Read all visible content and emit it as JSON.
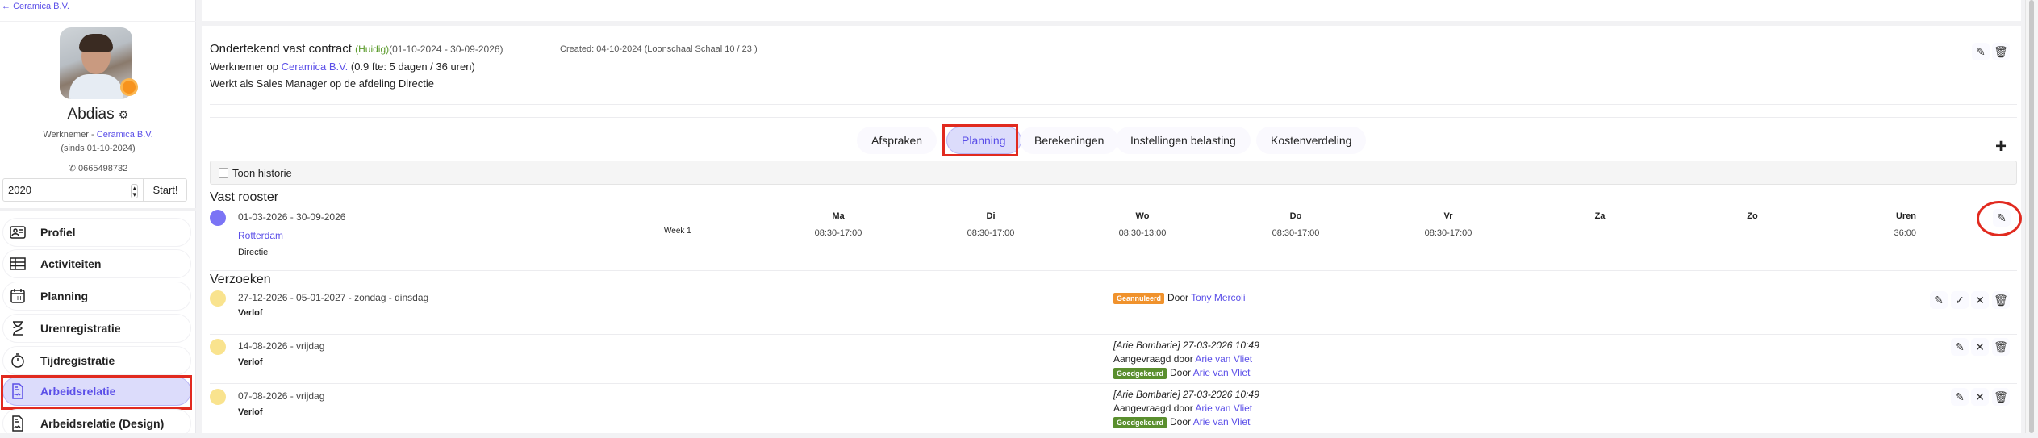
{
  "sidebar": {
    "back_link": "Ceramica B.V.",
    "name": "Abdias",
    "role": "Werknemer - ",
    "company": "Ceramica B.V.",
    "since": "(sinds 01-10-2024)",
    "phone": "0665498732",
    "year_value": "2020",
    "start_label": "Start!",
    "nav": [
      {
        "label": "Profiel",
        "icon": "id-card-icon"
      },
      {
        "label": "Activiteiten",
        "icon": "table-icon"
      },
      {
        "label": "Planning",
        "icon": "calendar-icon"
      },
      {
        "label": "Urenregistratie",
        "icon": "hourglass-icon"
      },
      {
        "label": "Tijdregistratie",
        "icon": "stopwatch-icon"
      },
      {
        "label": "Arbeidsrelatie",
        "icon": "document-icon",
        "active": true
      },
      {
        "label": "Arbeidsrelatie (Design)",
        "icon": "document-icon"
      }
    ]
  },
  "contract": {
    "title": "Ondertekend vast contract",
    "status": "(Huidig)",
    "period": "(01-10-2024 - 30-09-2026)",
    "created": "Created: 04-10-2024 (Loonschaal Schaal 10 / 23 )",
    "employee_prefix": "Werknemer op ",
    "employee_company": "Ceramica B.V.",
    "employee_suffix": " (0.9 fte: 5 dagen / 36 uren)",
    "role_line": "Werkt als Sales Manager op de afdeling Directie"
  },
  "tabs": [
    "Afspraken",
    "Planning",
    "Berekeningen",
    "Instellingen belasting",
    "Kostenverdeling"
  ],
  "active_tab": "Planning",
  "toon_historie": "Toon historie",
  "rooster": {
    "title": "Vast rooster",
    "period": "01-03-2026 - 30-09-2026",
    "location": "Rotterdam",
    "department": "Directie",
    "week": "Week 1",
    "days": [
      {
        "label": "Ma",
        "time": "08:30-17:00"
      },
      {
        "label": "Di",
        "time": "08:30-17:00"
      },
      {
        "label": "Wo",
        "time": "08:30-13:00"
      },
      {
        "label": "Do",
        "time": "08:30-17:00"
      },
      {
        "label": "Vr",
        "time": "08:30-17:00"
      },
      {
        "label": "Za",
        "time": ""
      },
      {
        "label": "Zo",
        "time": ""
      }
    ],
    "hours_label": "Uren",
    "hours": "36:00"
  },
  "verzoeken": {
    "title": "Verzoeken",
    "items": [
      {
        "date": "27-12-2026 - 05-01-2027 - zondag - dinsdag",
        "type": "Verlof",
        "badge": "Geannuleerd",
        "door": "Door ",
        "by": "Tony Mercoli"
      },
      {
        "date": "14-08-2026 - vrijdag",
        "type": "Verlof",
        "note": "[Arie Bombarie] 27-03-2026 10:49",
        "requested": "Aangevraagd door ",
        "requested_by": "Arie van Vliet",
        "badge": "Goedgekeurd",
        "door": "Door ",
        "by": "Arie van Vliet"
      },
      {
        "date": "07-08-2026 - vrijdag",
        "type": "Verlof",
        "note": "[Arie Bombarie] 27-03-2026 10:49",
        "requested": "Aangevraagd door ",
        "requested_by": "Arie van Vliet",
        "badge": "Goedgekeurd",
        "door": "Door ",
        "by": "Arie van Vliet"
      }
    ]
  },
  "colors": {
    "accent": "#5b4fe8",
    "cancelled": "#f0922c",
    "approved": "#5a8f2e",
    "huidig": "#5a9a2a",
    "rooster_dot": "#7b74f5",
    "verzoek_dot": "#f9e38e"
  }
}
